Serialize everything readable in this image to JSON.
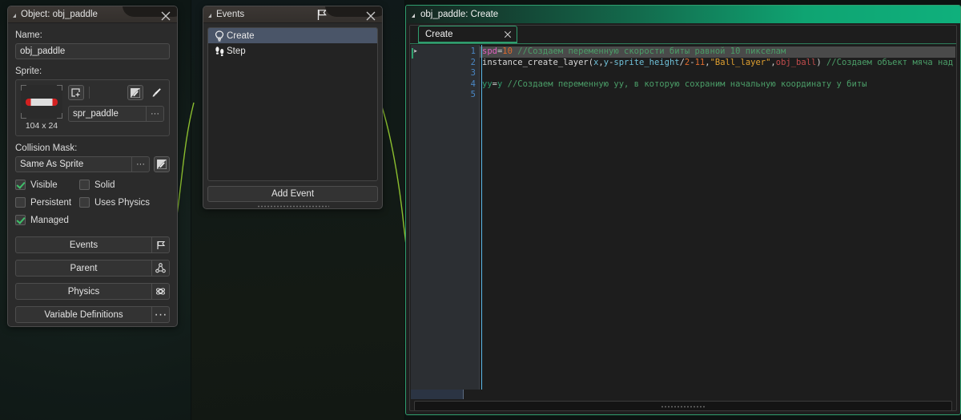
{
  "object_panel": {
    "title": "Object: obj_paddle",
    "close_icon": "close-icon",
    "name_label": "Name:",
    "name_value": "obj_paddle",
    "sprite_label": "Sprite:",
    "sprite_name": "spr_paddle",
    "sprite_dims": "104 x 24",
    "sprite_dots": "···",
    "collision_label": "Collision Mask:",
    "collision_value": "Same As Sprite",
    "collision_dots": "···",
    "checkboxes": [
      {
        "label": "Visible",
        "checked": true
      },
      {
        "label": "Solid",
        "checked": false
      },
      {
        "label": "Persistent",
        "checked": false
      },
      {
        "label": "Uses Physics",
        "checked": false
      },
      {
        "label": "Managed",
        "checked": true
      }
    ],
    "buttons": [
      {
        "label": "Events",
        "icon": "flag-icon"
      },
      {
        "label": "Parent",
        "icon": "hierarchy-icon"
      },
      {
        "label": "Physics",
        "icon": "atom-icon"
      },
      {
        "label": "Variable Definitions",
        "icon": "ellipsis-icon"
      }
    ]
  },
  "events_panel": {
    "title": "Events",
    "title_icon": "flag-icon",
    "close_icon": "close-icon",
    "items": [
      {
        "label": "Create",
        "icon": "lightbulb-icon",
        "selected": true
      },
      {
        "label": "Step",
        "icon": "footsteps-icon",
        "selected": false
      }
    ],
    "add_event_label": "Add Event"
  },
  "code_window": {
    "title": "obj_paddle: Create",
    "tab_label": "Create",
    "tab_close_icon": "close-icon",
    "line_numbers": [
      "1",
      "2",
      "3",
      "4",
      "5"
    ],
    "lines": [
      [
        {
          "t": "spd",
          "c": "tk-var"
        },
        {
          "t": "=",
          "c": "tk-pl"
        },
        {
          "t": "10",
          "c": "tk-num"
        },
        {
          "t": " //Создаем переменную скорости биты равной 10 пикселам",
          "c": "tk-com"
        }
      ],
      [
        {
          "t": "instance_create_layer",
          "c": "tk-fn"
        },
        {
          "t": "(",
          "c": "tk-pl"
        },
        {
          "t": "x",
          "c": "tk-kw"
        },
        {
          "t": ",",
          "c": "tk-pl"
        },
        {
          "t": "y",
          "c": "tk-kw"
        },
        {
          "t": "-",
          "c": "tk-pl"
        },
        {
          "t": "sprite_height",
          "c": "tk-kw"
        },
        {
          "t": "/",
          "c": "tk-pl"
        },
        {
          "t": "2",
          "c": "tk-num"
        },
        {
          "t": "-",
          "c": "tk-pl"
        },
        {
          "t": "11",
          "c": "tk-num"
        },
        {
          "t": ",",
          "c": "tk-pl"
        },
        {
          "t": "\"Ball_layer\"",
          "c": "tk-str"
        },
        {
          "t": ",",
          "c": "tk-pl"
        },
        {
          "t": "obj_ball",
          "c": "tk-obj"
        },
        {
          "t": ")",
          "c": "tk-pl"
        },
        {
          "t": " //Создаем объект мяча над битой",
          "c": "tk-com"
        }
      ],
      [],
      [
        {
          "t": "yy",
          "c": "tk-grn"
        },
        {
          "t": "=",
          "c": "tk-pl"
        },
        {
          "t": "y",
          "c": "tk-grn"
        },
        {
          "t": " //Создаем переменную уу, в которую сохраним начальную координату у биты",
          "c": "tk-com"
        }
      ],
      []
    ]
  },
  "colors": {
    "accent_green": "#2f9e6e",
    "title_teal": "#0fb07c",
    "selection_blue": "#4a5568",
    "checkbox_check": "#3fbf6a",
    "line_number": "#4a87c4",
    "comment": "#4b9e68",
    "string": "#e0a030",
    "number": "#e06c2e",
    "variable": "#e060c0"
  }
}
